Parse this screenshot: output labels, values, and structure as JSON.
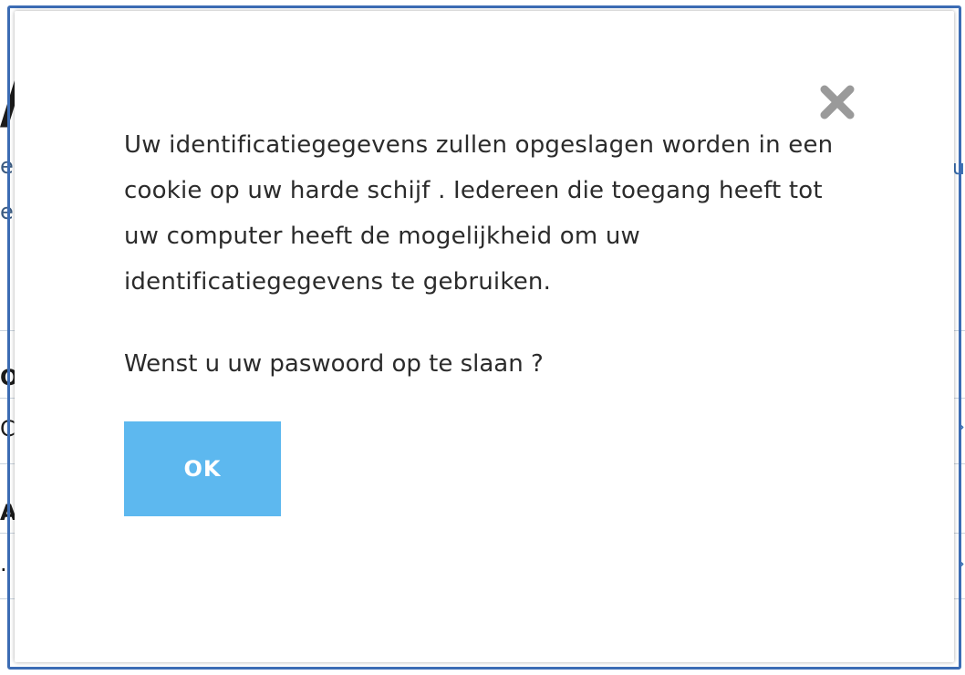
{
  "dialog": {
    "message": "Uw identificatiegegevens zullen opgeslagen worden in een cookie op uw harde schijf . Iedereen die toegang heeft tot uw computer heeft de mogelijkheid om uw identificatiegegevens te gebruiken.",
    "question": "Wenst u uw paswoord op te slaan ?",
    "ok_label": "OK",
    "close_icon": "close-icon"
  },
  "colors": {
    "frame": "#3c6cb4",
    "ok_button": "#5db8ef",
    "close_icon": "#9a9a9a",
    "text": "#2b2b2b"
  }
}
